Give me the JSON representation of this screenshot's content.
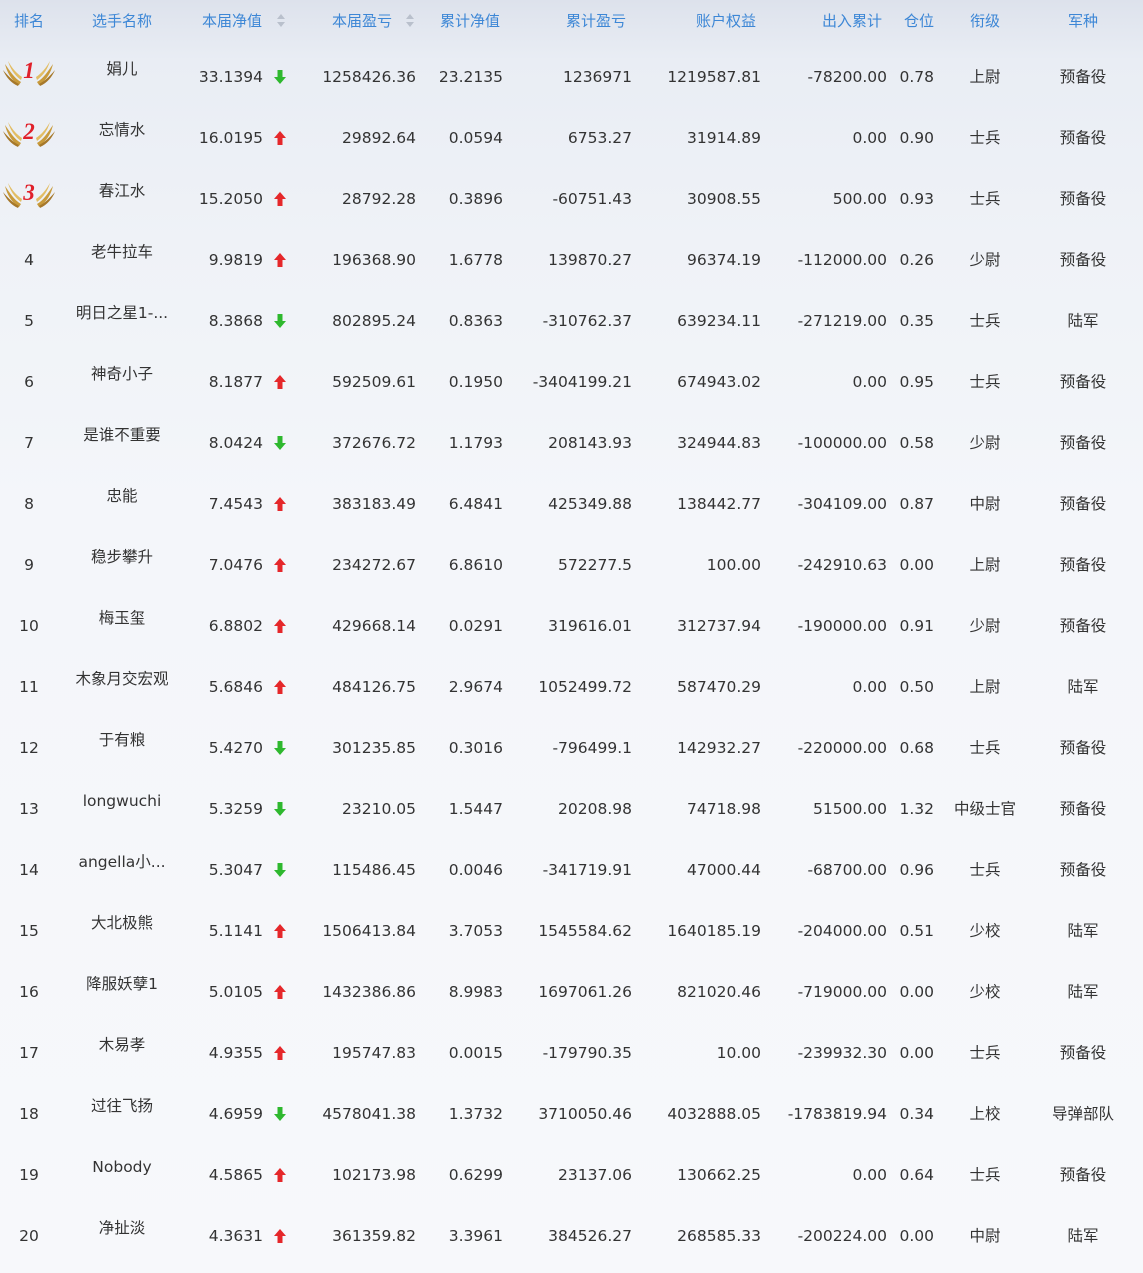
{
  "headers": {
    "rank": "排名",
    "name": "选手名称",
    "net": "本届净值",
    "profit": "本届盈亏",
    "cum_net": "累计净值",
    "cum_profit": "累计盈亏",
    "equity": "账户权益",
    "inout": "出入累计",
    "position": "仓位",
    "title": "衔级",
    "branch": "军种"
  },
  "colors": {
    "header": "#3d87d6",
    "up": "#e5272a",
    "down": "#2eb82e",
    "medal_number": "#e0202a"
  },
  "rows": [
    {
      "rank": "1",
      "name": "娟儿",
      "net": "33.1394",
      "dir": "down",
      "profit": "1258426.36",
      "cum_net": "23.2135",
      "cum_profit": "1236971",
      "equity": "1219587.81",
      "inout": "-78200.00",
      "position": "0.78",
      "title": "上尉",
      "branch": "预备役"
    },
    {
      "rank": "2",
      "name": "忘情水",
      "net": "16.0195",
      "dir": "up",
      "profit": "29892.64",
      "cum_net": "0.0594",
      "cum_profit": "6753.27",
      "equity": "31914.89",
      "inout": "0.00",
      "position": "0.90",
      "title": "士兵",
      "branch": "预备役"
    },
    {
      "rank": "3",
      "name": "春江水",
      "net": "15.2050",
      "dir": "up",
      "profit": "28792.28",
      "cum_net": "0.3896",
      "cum_profit": "-60751.43",
      "equity": "30908.55",
      "inout": "500.00",
      "position": "0.93",
      "title": "士兵",
      "branch": "预备役"
    },
    {
      "rank": "4",
      "name": "老牛拉车",
      "net": "9.9819",
      "dir": "up",
      "profit": "196368.90",
      "cum_net": "1.6778",
      "cum_profit": "139870.27",
      "equity": "96374.19",
      "inout": "-112000.00",
      "position": "0.26",
      "title": "少尉",
      "branch": "预备役"
    },
    {
      "rank": "5",
      "name": "明日之星1-...",
      "net": "8.3868",
      "dir": "down",
      "profit": "802895.24",
      "cum_net": "0.8363",
      "cum_profit": "-310762.37",
      "equity": "639234.11",
      "inout": "-271219.00",
      "position": "0.35",
      "title": "士兵",
      "branch": "陆军"
    },
    {
      "rank": "6",
      "name": "神奇小子",
      "net": "8.1877",
      "dir": "up",
      "profit": "592509.61",
      "cum_net": "0.1950",
      "cum_profit": "-3404199.21",
      "equity": "674943.02",
      "inout": "0.00",
      "position": "0.95",
      "title": "士兵",
      "branch": "预备役"
    },
    {
      "rank": "7",
      "name": "是谁不重要",
      "net": "8.0424",
      "dir": "down",
      "profit": "372676.72",
      "cum_net": "1.1793",
      "cum_profit": "208143.93",
      "equity": "324944.83",
      "inout": "-100000.00",
      "position": "0.58",
      "title": "少尉",
      "branch": "预备役"
    },
    {
      "rank": "8",
      "name": "忠能",
      "net": "7.4543",
      "dir": "up",
      "profit": "383183.49",
      "cum_net": "6.4841",
      "cum_profit": "425349.88",
      "equity": "138442.77",
      "inout": "-304109.00",
      "position": "0.87",
      "title": "中尉",
      "branch": "预备役"
    },
    {
      "rank": "9",
      "name": "稳步攀升",
      "net": "7.0476",
      "dir": "up",
      "profit": "234272.67",
      "cum_net": "6.8610",
      "cum_profit": "572277.5",
      "equity": "100.00",
      "inout": "-242910.63",
      "position": "0.00",
      "title": "上尉",
      "branch": "预备役"
    },
    {
      "rank": "10",
      "name": "梅玉玺",
      "net": "6.8802",
      "dir": "up",
      "profit": "429668.14",
      "cum_net": "0.0291",
      "cum_profit": "319616.01",
      "equity": "312737.94",
      "inout": "-190000.00",
      "position": "0.91",
      "title": "少尉",
      "branch": "预备役"
    },
    {
      "rank": "11",
      "name": "木象月交宏观",
      "net": "5.6846",
      "dir": "up",
      "profit": "484126.75",
      "cum_net": "2.9674",
      "cum_profit": "1052499.72",
      "equity": "587470.29",
      "inout": "0.00",
      "position": "0.50",
      "title": "上尉",
      "branch": "陆军"
    },
    {
      "rank": "12",
      "name": "于有粮",
      "net": "5.4270",
      "dir": "down",
      "profit": "301235.85",
      "cum_net": "0.3016",
      "cum_profit": "-796499.1",
      "equity": "142932.27",
      "inout": "-220000.00",
      "position": "0.68",
      "title": "士兵",
      "branch": "预备役"
    },
    {
      "rank": "13",
      "name": "longwuchi",
      "net": "5.3259",
      "dir": "down",
      "profit": "23210.05",
      "cum_net": "1.5447",
      "cum_profit": "20208.98",
      "equity": "74718.98",
      "inout": "51500.00",
      "position": "1.32",
      "title": "中级士官",
      "branch": "预备役"
    },
    {
      "rank": "14",
      "name": "angella小...",
      "net": "5.3047",
      "dir": "down",
      "profit": "115486.45",
      "cum_net": "0.0046",
      "cum_profit": "-341719.91",
      "equity": "47000.44",
      "inout": "-68700.00",
      "position": "0.96",
      "title": "士兵",
      "branch": "预备役"
    },
    {
      "rank": "15",
      "name": "大北极熊",
      "net": "5.1141",
      "dir": "up",
      "profit": "1506413.84",
      "cum_net": "3.7053",
      "cum_profit": "1545584.62",
      "equity": "1640185.19",
      "inout": "-204000.00",
      "position": "0.51",
      "title": "少校",
      "branch": "陆军"
    },
    {
      "rank": "16",
      "name": "降服妖孽1",
      "net": "5.0105",
      "dir": "up",
      "profit": "1432386.86",
      "cum_net": "8.9983",
      "cum_profit": "1697061.26",
      "equity": "821020.46",
      "inout": "-719000.00",
      "position": "0.00",
      "title": "少校",
      "branch": "陆军"
    },
    {
      "rank": "17",
      "name": "木易孝",
      "net": "4.9355",
      "dir": "up",
      "profit": "195747.83",
      "cum_net": "0.0015",
      "cum_profit": "-179790.35",
      "equity": "10.00",
      "inout": "-239932.30",
      "position": "0.00",
      "title": "士兵",
      "branch": "预备役"
    },
    {
      "rank": "18",
      "name": "过往飞扬",
      "net": "4.6959",
      "dir": "down",
      "profit": "4578041.38",
      "cum_net": "1.3732",
      "cum_profit": "3710050.46",
      "equity": "4032888.05",
      "inout": "-1783819.94",
      "position": "0.34",
      "title": "上校",
      "branch": "导弹部队"
    },
    {
      "rank": "19",
      "name": "Nobody",
      "net": "4.5865",
      "dir": "up",
      "profit": "102173.98",
      "cum_net": "0.6299",
      "cum_profit": "23137.06",
      "equity": "130662.25",
      "inout": "0.00",
      "position": "0.64",
      "title": "士兵",
      "branch": "预备役"
    },
    {
      "rank": "20",
      "name": "净扯淡",
      "net": "4.3631",
      "dir": "up",
      "profit": "361359.82",
      "cum_net": "3.3961",
      "cum_profit": "384526.27",
      "equity": "268585.33",
      "inout": "-200224.00",
      "position": "0.00",
      "title": "中尉",
      "branch": "陆军"
    }
  ]
}
